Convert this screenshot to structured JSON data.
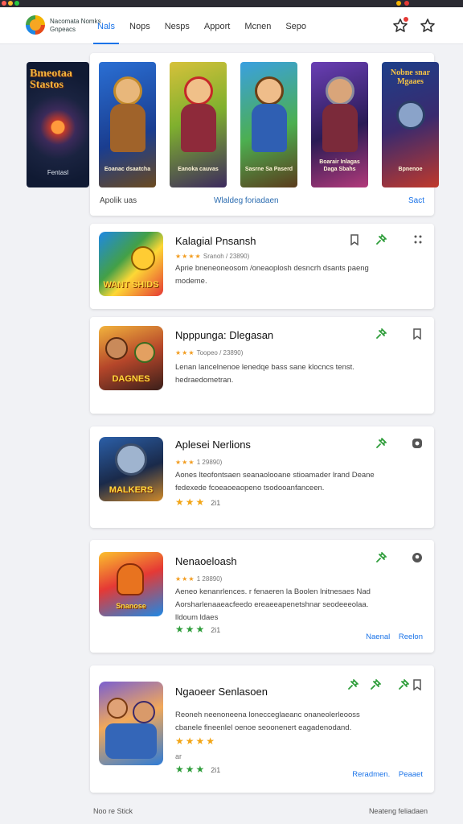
{
  "colors": {
    "accent": "#1a73e8",
    "pin_green": "#2e9d3a",
    "star_orange": "#f29c1f",
    "page_bg": "#f1f2f5"
  },
  "brand": {
    "line1": "Nacomata Nomks",
    "line2": "Gnpeacs"
  },
  "nav": {
    "tabs": [
      "Nals",
      "Nops",
      "Nesps",
      "Apport",
      "Mcnen",
      "Sepo"
    ],
    "active_index": 0
  },
  "header_icons": [
    "star-notification-icon",
    "star-outline-icon"
  ],
  "featured": {
    "title": "Bmeotaa Stastos",
    "caption": "Fentasl"
  },
  "hero": {
    "posters": [
      {
        "caption": "Eoanac dsaatcha"
      },
      {
        "caption": "Eanoka cauvas"
      },
      {
        "caption": "Sasrne Sa Paserd"
      },
      {
        "caption": "Boarair Inlagas Daga Sbahs"
      },
      {
        "caption": "Bpnenoe"
      }
    ],
    "banner_title": "Nobne snar Mgaaes",
    "footer_left": "Apolik uas",
    "footer_mid": "Wlaldeg foriadaen",
    "footer_right": "Sact"
  },
  "apps": [
    {
      "title": "Kalagial Pnsansh",
      "meta_stars": "★★★★",
      "meta_text": "Sranoh / 23890)",
      "desc": "Aprie bneneoneosom /oneaoplosh desncrh dsants paeng modeme.",
      "thumb_caption": "WANT SHIDS",
      "icons": [
        "bookmark-icon",
        "pin-icon",
        "more-icon"
      ]
    },
    {
      "title": "Npppunga: Dlegasan",
      "meta_stars": "★★★",
      "meta_text": "Toopeo / 23890)",
      "desc": "Lenan lancelnenoe lenedqe bass sane klocncs tenst. hedraedometran.",
      "thumb_caption": "DAGNES",
      "icons": [
        "pin-icon",
        "bookmark-icon"
      ]
    },
    {
      "title": "Aplesei Nerlions",
      "meta_stars": "★★★",
      "meta_text": "1 29890)",
      "desc": "Aones lteofontsaen seanaolooane stioamader lrand Deane fedexede fcoeaoeaopeno tsodooanfanceen.",
      "rating_stars": "★★★",
      "rating_num": "2i1",
      "thumb_caption": "MALKERS",
      "icons": [
        "pin-icon",
        "settings-icon"
      ]
    },
    {
      "title": "Nenaoeloash",
      "meta_stars": "★★★",
      "meta_text": "1 28890)",
      "desc": "Aeneo kenanrlences. r fenaeren la Boolen lnitnesaes Nad Aorsharlenaaeacfeedo ereaeeapenetshnar seodeeeolaa. lldoum ldaes",
      "rating_stars": "★★★",
      "rating_num": "2i1",
      "links": [
        "Naenal",
        "Reelon"
      ],
      "thumb_caption": "Snanose",
      "icons": [
        "pin-icon",
        "location-icon"
      ]
    },
    {
      "title": "Ngaoeer Senlasoen",
      "desc": "Reoneh neenoneena lonecceglaeanc onaneolerleooss cbanele fineenlel oenoe seoonenert eagadenodand.",
      "stars_yellow": "★★★★",
      "small": "ar",
      "rating_stars": "★★★",
      "rating_num": "2i1",
      "links": [
        "Reradmen.",
        "Peaaet"
      ],
      "icons": [
        "pin-icon",
        "pin-icon",
        "pin-icon",
        "bookmark-icon"
      ]
    }
  ],
  "footer": {
    "left": "Noo re Stick",
    "right": "Neateng feliadaen"
  }
}
